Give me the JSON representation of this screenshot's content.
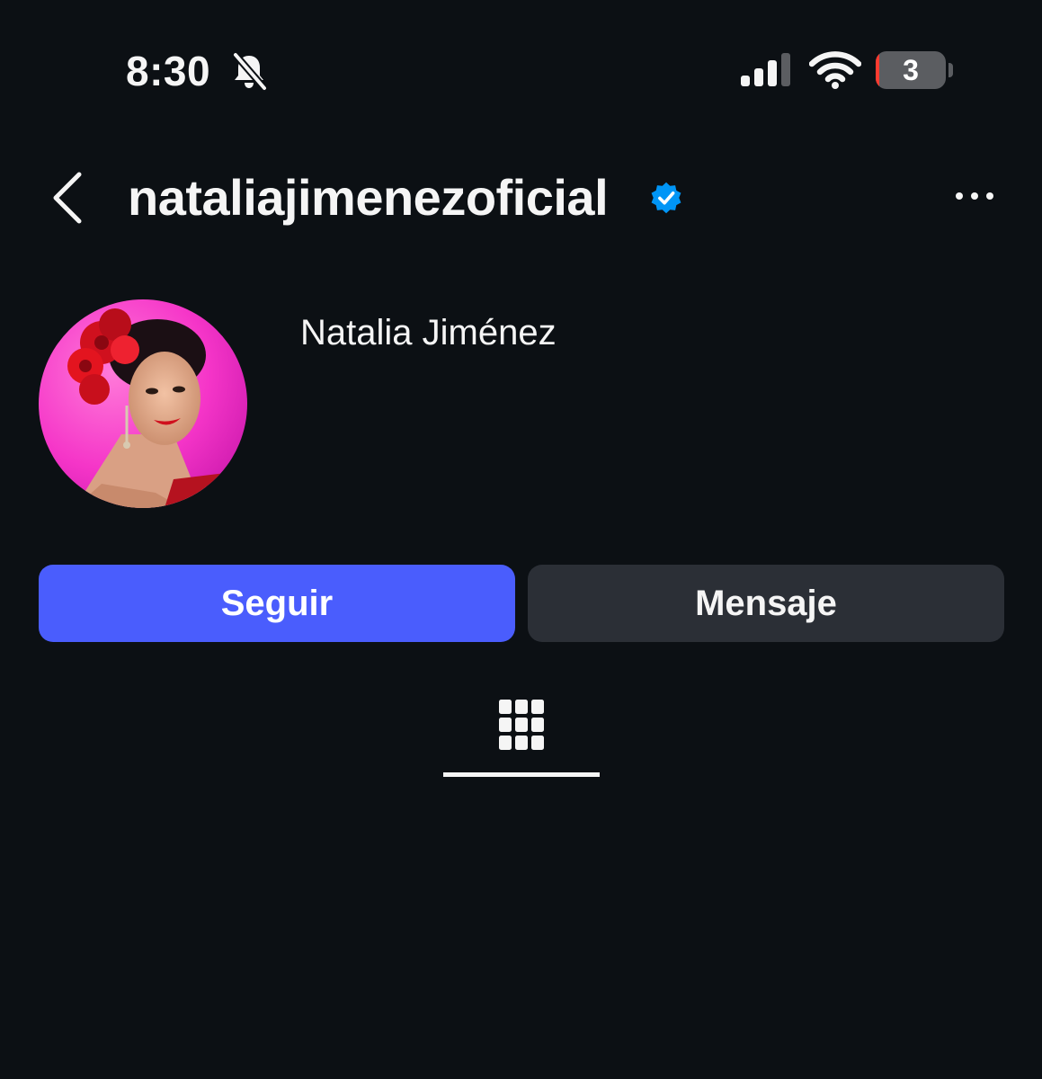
{
  "status_bar": {
    "time": "8:30",
    "silent_icon": "bell-slash-icon",
    "signal_icon": "cellular-signal-icon",
    "wifi_icon": "wifi-icon",
    "battery_level": "3",
    "battery_fraction": 0.03,
    "battery_color": "#ff3b30"
  },
  "header": {
    "back_icon": "chevron-left-icon",
    "username": "nataliajimenezoficial",
    "verified_icon": "verified-badge-icon",
    "verified_color": "#0095f6",
    "more_icon": "ellipsis-icon"
  },
  "profile": {
    "display_name": "Natalia Jiménez",
    "avatar": "profile-photo"
  },
  "actions": {
    "follow_label": "Seguir",
    "message_label": "Mensaje",
    "follow_color": "#4a5dfd"
  },
  "tabs": [
    {
      "icon": "grid-icon",
      "active": true
    }
  ]
}
